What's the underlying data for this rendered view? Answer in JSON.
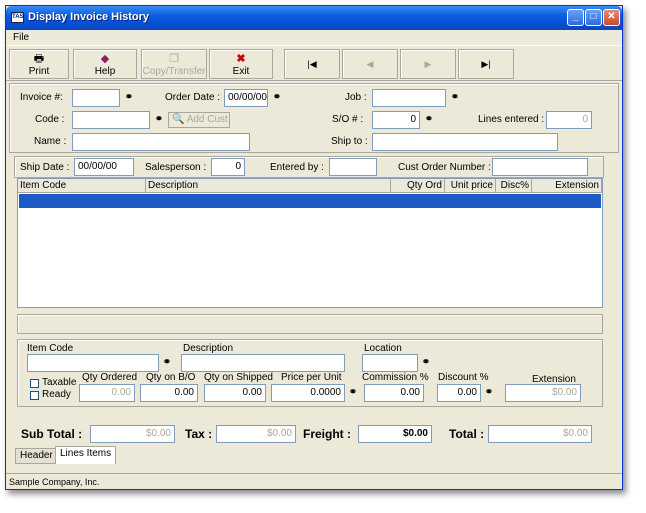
{
  "window": {
    "title": "Display Invoice History",
    "app_icon": "TAS"
  },
  "menu": {
    "file": "File"
  },
  "toolbar": {
    "print": "Print",
    "help": "Help",
    "copy": "Copy/Transfer",
    "exit": "Exit",
    "nav": {
      "first": "|◀",
      "prev": "◀",
      "next": "▶",
      "last": "▶|"
    }
  },
  "header": {
    "invoice_label": "Invoice #:",
    "invoice_value": "",
    "order_date_label": "Order Date :",
    "order_date_value": "00/00/00",
    "job_label": "Job :",
    "job_value": "",
    "code_label": "Code :",
    "code_value": "",
    "add_cust": "Add Cust",
    "so_label": "S/O # :",
    "so_value": "0",
    "lines_entered_label": "Lines entered :",
    "lines_entered_value": "0",
    "name_label": "Name :",
    "name_value": "",
    "ship_to_label": "Ship to :",
    "ship_to_value": ""
  },
  "shipbar": {
    "ship_date_label": "Ship Date :",
    "ship_date_value": "00/00/00",
    "salesperson_label": "Salesperson :",
    "salesperson_value": "0",
    "entered_by_label": "Entered by :",
    "entered_by_value": "",
    "cust_order_label": "Cust Order Number :",
    "cust_order_value": ""
  },
  "grid": {
    "columns": [
      "Item Code",
      "Description",
      "Qty Ord",
      "Unit price",
      "Disc%",
      "Extension"
    ]
  },
  "detail": {
    "item_code_label": "Item Code",
    "item_code_value": "",
    "description_label": "Description",
    "description_value": "",
    "location_label": "Location",
    "location_value": "",
    "taxable_label": "Taxable",
    "ready_label": "Ready",
    "qty_ordered_label": "Qty Ordered",
    "qty_ordered_value": "0.00",
    "qty_bo_label": "Qty on B/O",
    "qty_bo_value": "0.00",
    "qty_shipped_label": "Qty on Shipped",
    "qty_shipped_value": "0.00",
    "price_label": "Price per Unit",
    "price_value": "0.0000",
    "commission_label": "Commission %",
    "commission_value": "0.00",
    "discount_label": "Discount %",
    "discount_value": "0.00",
    "extension_label": "Extension",
    "extension_value": "$0.00"
  },
  "totals": {
    "subtotal_label": "Sub Total :",
    "subtotal_value": "$0.00",
    "tax_label": "Tax :",
    "tax_value": "$0.00",
    "freight_label": "Freight :",
    "freight_value": "$0.00",
    "total_label": "Total :",
    "total_value": "$0.00"
  },
  "tabs": {
    "header": "Header",
    "lines": "Lines Items"
  },
  "status": {
    "company": "Sample Company, Inc."
  }
}
